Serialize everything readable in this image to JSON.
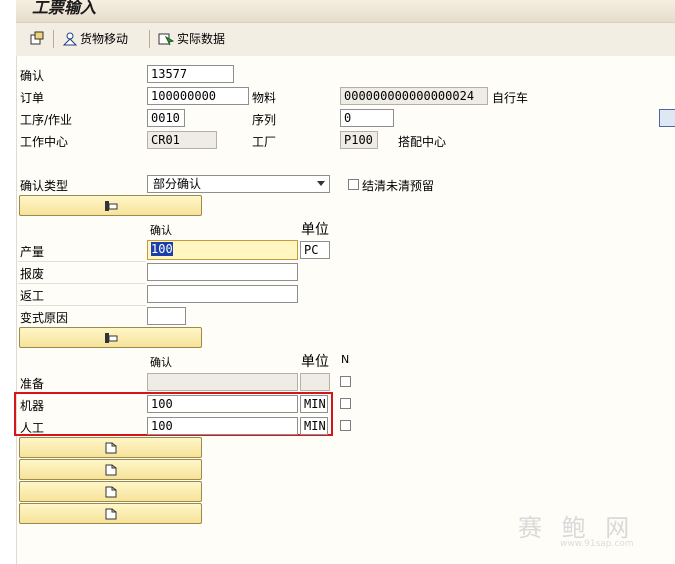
{
  "window": {
    "title": "工票输入"
  },
  "toolbar": {
    "goods_movement": "货物移动",
    "actual_data": "实际数据"
  },
  "header": {
    "confirmation_label": "确认",
    "confirmation_value": "13577",
    "order_label": "订单",
    "order_value": "100000000",
    "material_label": "物料",
    "material_value": "000000000000000024",
    "material_desc": "自行车",
    "operation_label": "工序/作业",
    "operation_value": "0010",
    "sequence_label": "序列",
    "sequence_value": "0",
    "workcenter_label": "工作中心",
    "workcenter_value": "CR01",
    "plant_label": "工厂",
    "plant_value": "P100",
    "workcenter_desc": "搭配中心"
  },
  "conf_type": {
    "label": "确认类型",
    "value": "部分确认",
    "clear_res_label": "结清未清预留"
  },
  "quantities": {
    "col_confirm": "确认",
    "col_unit": "单位",
    "yield_label": "产量",
    "yield_value": "100",
    "yield_unit": "PC",
    "scrap_label": "报废",
    "scrap_value": "",
    "rework_label": "返工",
    "rework_value": "",
    "variance_label": "变式原因",
    "variance_value": ""
  },
  "activities": {
    "col_confirm": "确认",
    "col_unit": "单位",
    "col_n": "N",
    "setup_label": "准备",
    "setup_value": "",
    "setup_unit": "",
    "machine_label": "机器",
    "machine_value": "100",
    "machine_unit": "MIN",
    "labor_label": "人工",
    "labor_value": "100",
    "labor_unit": "MIN"
  },
  "watermark": {
    "text": "赛 鲍 网",
    "url": "www.91sap.com"
  }
}
